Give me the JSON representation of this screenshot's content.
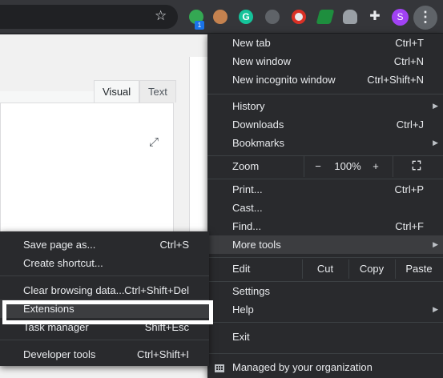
{
  "toolbar": {
    "badge_count": "1",
    "profile_initial": "S"
  },
  "editor": {
    "tab_visual": "Visual",
    "tab_text": "Text"
  },
  "main_menu": {
    "new_tab": "New tab",
    "new_tab_sc": "Ctrl+T",
    "new_window": "New window",
    "new_window_sc": "Ctrl+N",
    "incognito": "New incognito window",
    "incognito_sc": "Ctrl+Shift+N",
    "history": "History",
    "downloads": "Downloads",
    "downloads_sc": "Ctrl+J",
    "bookmarks": "Bookmarks",
    "zoom": "Zoom",
    "zoom_minus": "−",
    "zoom_level": "100%",
    "zoom_plus": "+",
    "print": "Print...",
    "print_sc": "Ctrl+P",
    "cast": "Cast...",
    "find": "Find...",
    "find_sc": "Ctrl+F",
    "more_tools": "More tools",
    "edit": "Edit",
    "cut": "Cut",
    "copy": "Copy",
    "paste": "Paste",
    "settings": "Settings",
    "help": "Help",
    "exit": "Exit",
    "managed": "Managed by your organization"
  },
  "sub_menu": {
    "save_page": "Save page as...",
    "save_page_sc": "Ctrl+S",
    "create_shortcut": "Create shortcut...",
    "clear_data": "Clear browsing data...",
    "clear_data_sc": "Ctrl+Shift+Del",
    "extensions": "Extensions",
    "task_manager": "Task manager",
    "task_manager_sc": "Shift+Esc",
    "developer_tools": "Developer tools",
    "developer_tools_sc": "Ctrl+Shift+I"
  },
  "colors": {
    "menu_bg": "#292a2d",
    "highlight": "#3c3d40",
    "accent": "#1a73e8"
  }
}
